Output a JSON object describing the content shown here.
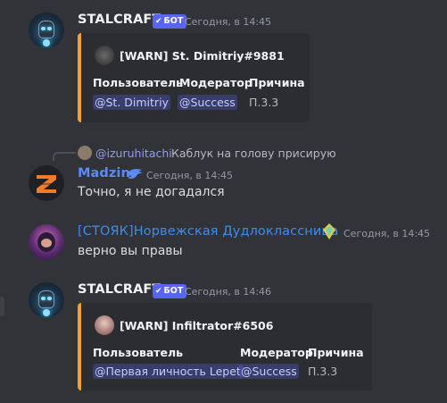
{
  "colors": {
    "background": "#313338",
    "embed_bar": "#f0a232",
    "bot_tag": "#5865f2",
    "madzin_name": "#5b8bf5",
    "norw_name": "#3b8cf0"
  },
  "messages": [
    {
      "author": "STALCRAFT",
      "bot_label": "БОТ",
      "timestamp": "Сегодня, в 14:45",
      "embed": {
        "title": "[WARN] St. Dimitriy#9881",
        "fields": [
          {
            "name": "Пользователь",
            "value": "@St. Dimitriy"
          },
          {
            "name": "Модератор",
            "value": "@Success"
          },
          {
            "name": "Причина",
            "value": "П.3.3"
          }
        ]
      }
    },
    {
      "reply": {
        "mention": "@izuruhitachi",
        "text": "Каблук на голову присирую"
      },
      "author": "Madzin",
      "badge_icon": "eagle-icon",
      "timestamp": "Сегодня, в 14:45",
      "text": "Точно, я не догадался"
    },
    {
      "author": "[СТОЯК]Норвежская Дудлоклассница",
      "badge_icon": "nitro-boost-icon",
      "timestamp": "Сегодня, в 14:45",
      "text": "верно вы правы"
    },
    {
      "author": "STALCRAFT",
      "bot_label": "БОТ",
      "timestamp": "Сегодня, в 14:46",
      "embed": {
        "title": "[WARN] Infiltrator#6506",
        "fields": [
          {
            "name": "Пользователь",
            "value": "@Первая личность Lepet"
          },
          {
            "name": "Модератор",
            "value": "@Success"
          },
          {
            "name": "Причина",
            "value": "П.3.3"
          }
        ]
      }
    }
  ]
}
